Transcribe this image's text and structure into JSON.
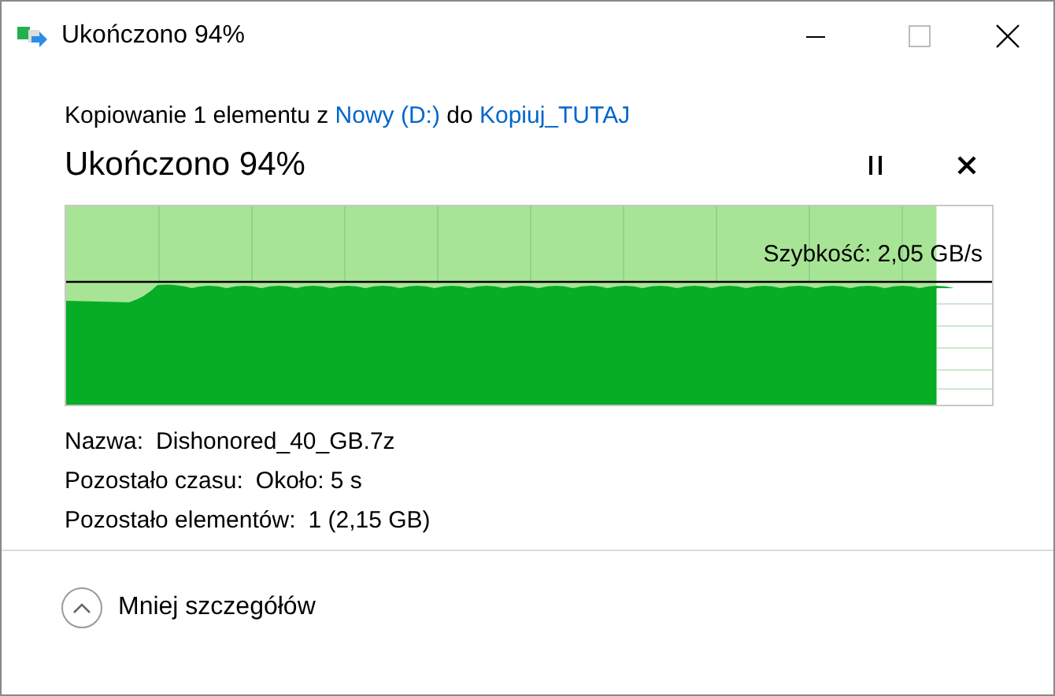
{
  "window": {
    "title": "Ukończono 94%"
  },
  "copy_line": {
    "prefix": "Kopiowanie 1 elementu z",
    "source": "Nowy (D:)",
    "middle": "do",
    "destination": "Kopiuj_TUTAJ"
  },
  "heading": "Ukończono 94%",
  "progress": {
    "level": 0.94,
    "speed": "Szybkość: 2,05 GB/s"
  },
  "details": [
    {
      "label": "Nazwa:",
      "value": "Dishonored_40_GB.7z"
    },
    {
      "label": "Pozostało czasu:",
      "value": "Około: 5 s"
    },
    {
      "label": "Pozostało elementów:",
      "value": "1 (2,15 GB)"
    }
  ],
  "footer": {
    "toggle": "Mniej szczegółów",
    "expanded": true
  }
}
